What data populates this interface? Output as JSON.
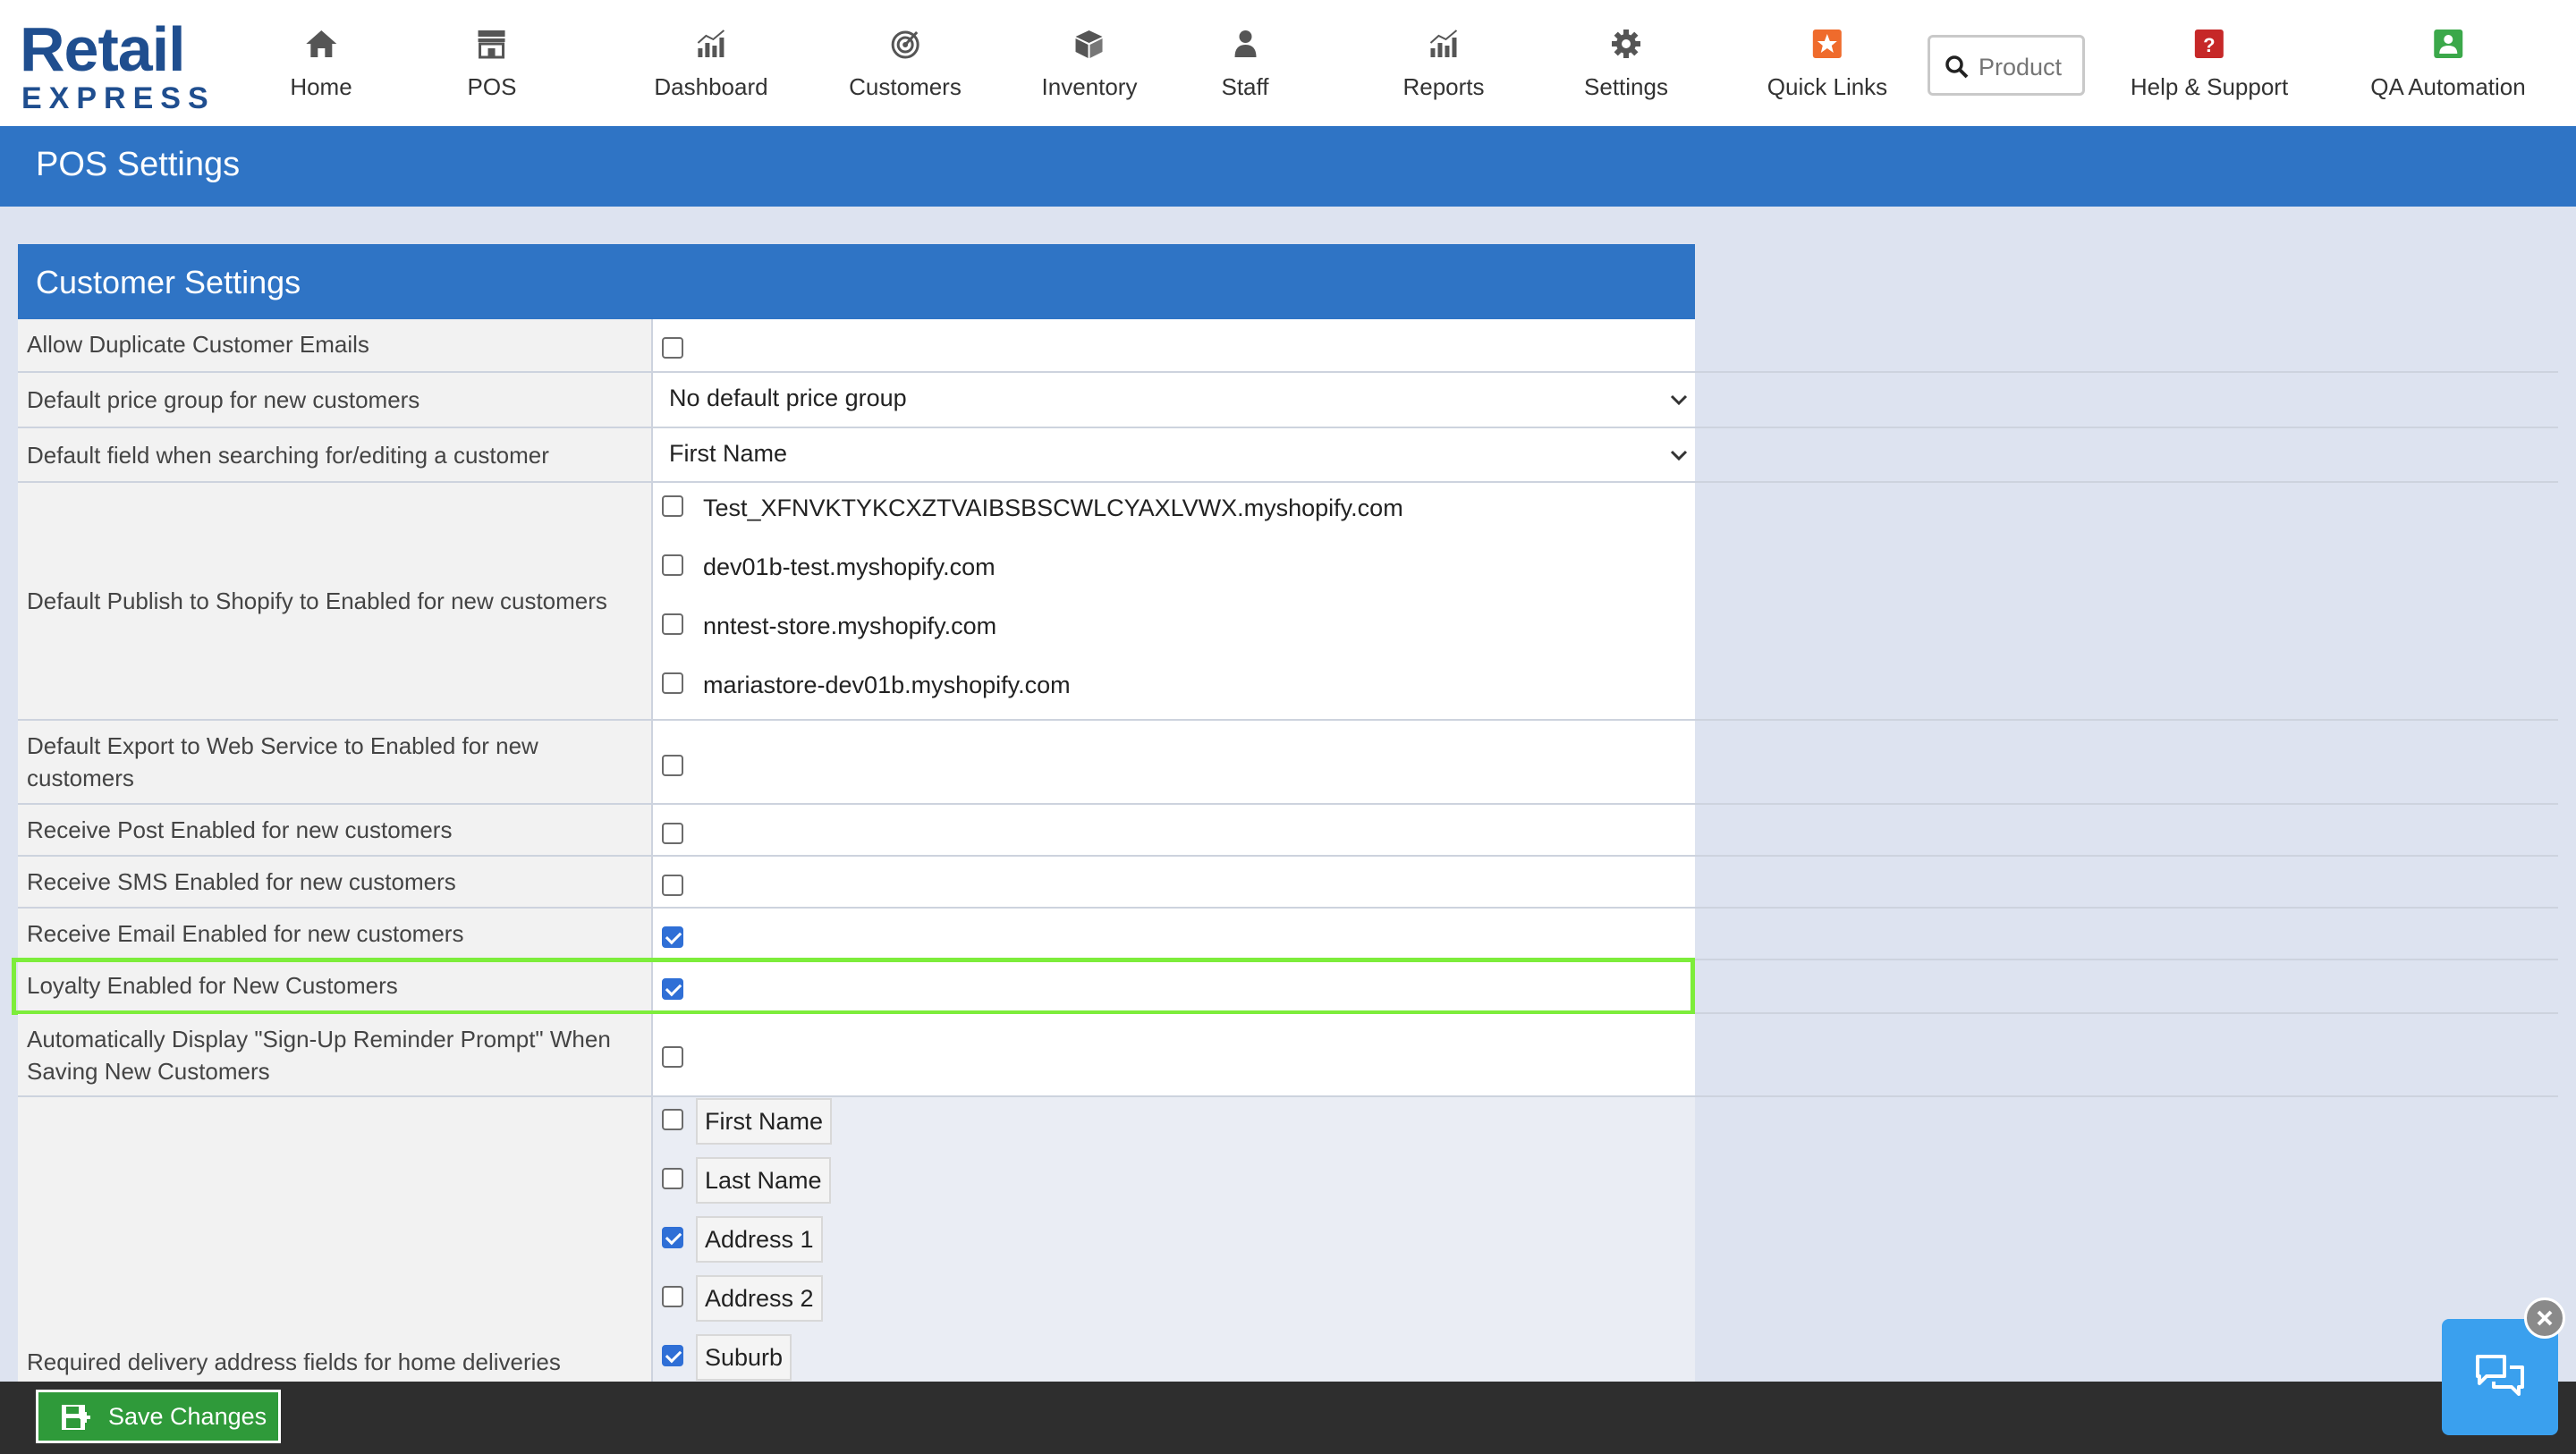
{
  "app": {
    "logo_line1": "Retail",
    "logo_line2": "EXPRESS"
  },
  "nav": {
    "items": [
      {
        "label": "Home",
        "icon": "home-icon"
      },
      {
        "label": "POS",
        "icon": "store-icon"
      },
      {
        "label": "Dashboard",
        "icon": "chart-icon"
      },
      {
        "label": "Customers",
        "icon": "target-icon"
      },
      {
        "label": "Inventory",
        "icon": "box-icon"
      },
      {
        "label": "Staff",
        "icon": "person-icon"
      },
      {
        "label": "Reports",
        "icon": "chart-icon"
      },
      {
        "label": "Settings",
        "icon": "gear-icon"
      },
      {
        "label": "Quick Links",
        "icon": "star-icon"
      },
      {
        "label": "Help & Support",
        "icon": "question-icon"
      },
      {
        "label": "QA Automation",
        "icon": "user-badge-icon"
      }
    ],
    "search_placeholder": "Product"
  },
  "page": {
    "title": "POS Settings"
  },
  "panel": {
    "title": "Customer Settings",
    "rows": [
      {
        "label": "Allow Duplicate Customer Emails",
        "checked": false
      },
      {
        "label": "Default price group for new customers",
        "value": "No default price group"
      },
      {
        "label": "Default field when searching for/editing a customer",
        "value": "First Name"
      },
      {
        "label": "Default Publish to Shopify to Enabled for new customers",
        "options": [
          {
            "label": "Test_XFNVKTYKCXZTVAIBSBSCWLCYAXLVWX.myshopify.com",
            "checked": false
          },
          {
            "label": "dev01b-test.myshopify.com",
            "checked": false
          },
          {
            "label": "nntest-store.myshopify.com",
            "checked": false
          },
          {
            "label": "mariastore-dev01b.myshopify.com",
            "checked": false
          }
        ]
      },
      {
        "label": "Default Export to Web Service to Enabled for new customers",
        "checked": false
      },
      {
        "label": "Receive Post Enabled for new customers",
        "checked": false
      },
      {
        "label": "Receive SMS Enabled for new customers",
        "checked": false
      },
      {
        "label": "Receive Email Enabled for new customers",
        "checked": true
      },
      {
        "label": "Loyalty Enabled for New Customers",
        "checked": true
      },
      {
        "label": "Automatically Display \"Sign-Up Reminder Prompt\" When Saving New Customers",
        "checked": false
      },
      {
        "label": "Required delivery address fields for home deliveries",
        "fields": [
          {
            "label": "First Name",
            "checked": false
          },
          {
            "label": "Last Name",
            "checked": false
          },
          {
            "label": "Address 1",
            "checked": true
          },
          {
            "label": "Address 2",
            "checked": false
          },
          {
            "label": "Suburb",
            "checked": true
          }
        ]
      }
    ]
  },
  "footer": {
    "save_label": "Save Changes"
  },
  "colors": {
    "brand": "#1f4e8f",
    "header": "#2f74c5",
    "save": "#2f9a3a",
    "highlight": "#7ded3b",
    "chat": "#3aa0ee"
  }
}
